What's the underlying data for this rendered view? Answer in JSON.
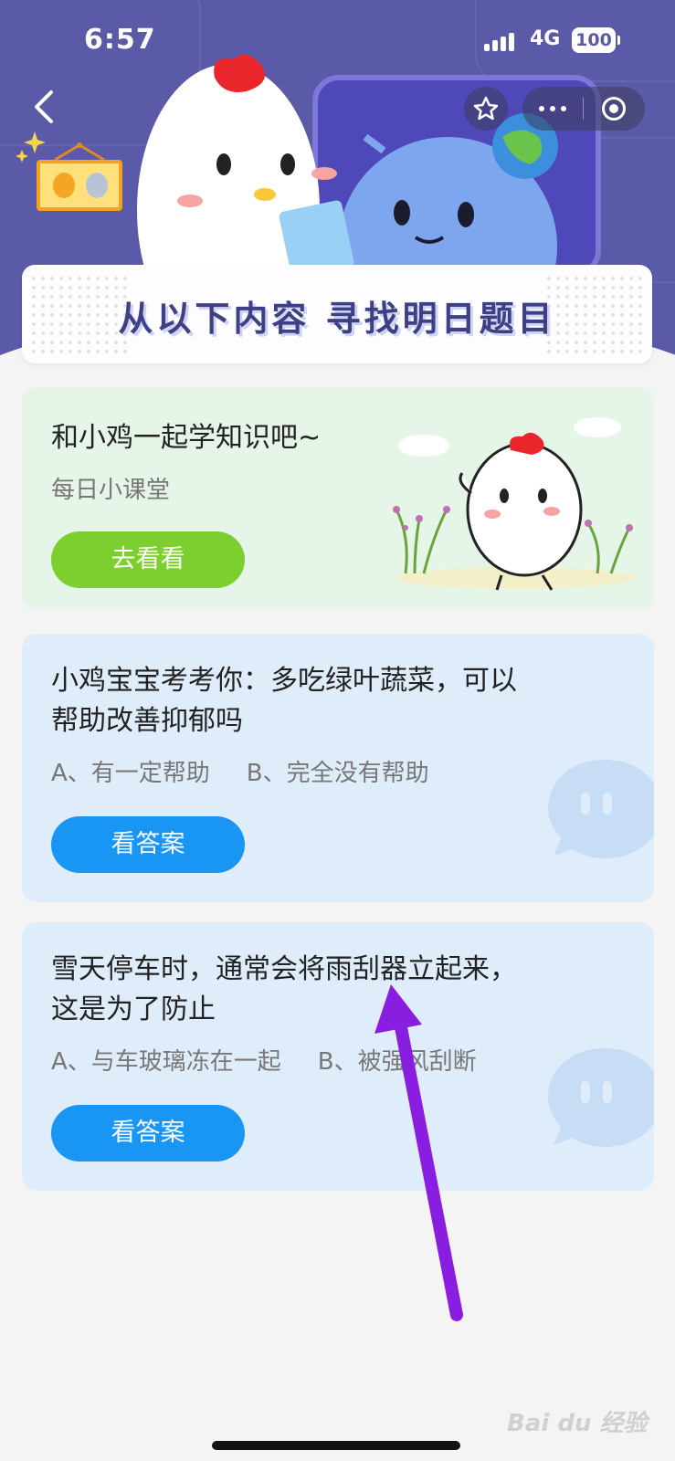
{
  "status_bar": {
    "time": "6:57",
    "network": "4G",
    "battery": "100"
  },
  "nav": {
    "back_icon": "chevron-left-icon",
    "favorite_icon": "star-icon",
    "more_icon": "ellipsis-icon",
    "close_icon": "target-icon"
  },
  "banner": {
    "title": "从以下内容 寻找明日题目"
  },
  "cards": [
    {
      "title": "和小鸡一起学知识吧~",
      "subtitle": "每日小课堂",
      "button_label": "去看看"
    },
    {
      "title_line1": "小鸡宝宝考考你：多吃绿叶蔬菜，可以",
      "title_line2": "帮助改善抑郁吗",
      "option_a": "A、有一定帮助",
      "option_b": "B、完全没有帮助",
      "button_label": "看答案"
    },
    {
      "title_line1": "雪天停车时，通常会将雨刮器立起来，",
      "title_line2": "这是为了防止",
      "option_a": "A、与车玻璃冻在一起",
      "option_b": "B、被强风刮断",
      "button_label": "看答案"
    }
  ],
  "watermark": "Bai du 经验",
  "colors": {
    "header": "#5a5aa8",
    "green_card": "#e5f6e8",
    "blue_card": "#dfedfb",
    "green_button": "#7ccf2e",
    "blue_button": "#1995f3",
    "arrow": "#8a1ee0"
  }
}
